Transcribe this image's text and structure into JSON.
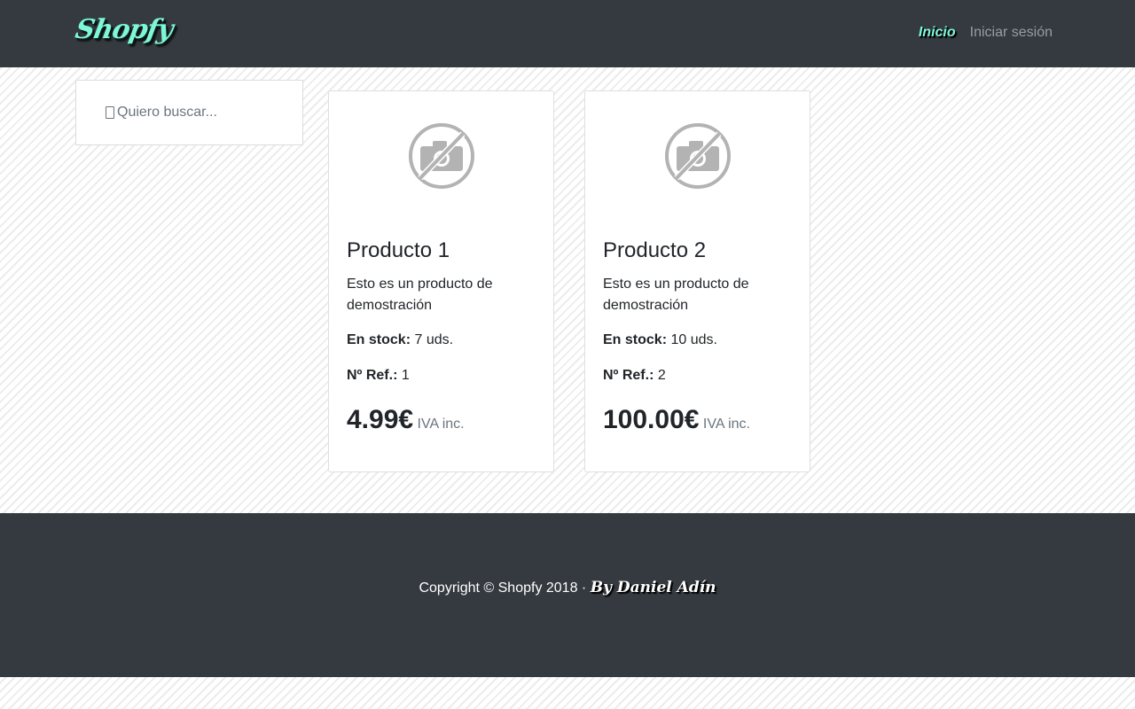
{
  "brand": {
    "logo_text": "Shopfy"
  },
  "nav": {
    "items": [
      {
        "label": "Inicio"
      },
      {
        "label": "Iniciar sesión"
      }
    ]
  },
  "search": {
    "placeholder": "Quiero buscar..."
  },
  "products": [
    {
      "title": "Producto 1",
      "description": "Esto es un producto de demostración",
      "stock_label": "En stock:",
      "stock_value": "7 uds.",
      "ref_label": "Nº Ref.:",
      "ref_value": "1",
      "price": "4.99€",
      "price_note": "IVA inc.",
      "image_icon": "no-photo-icon"
    },
    {
      "title": "Producto 2",
      "description": "Esto es un producto de demostración",
      "stock_label": "En stock:",
      "stock_value": "10 uds.",
      "ref_label": "Nº Ref.:",
      "ref_value": "2",
      "price": "100.00€",
      "price_note": "IVA inc.",
      "image_icon": "no-photo-icon"
    }
  ],
  "footer": {
    "copyright": "Copyright © Shopfy 2018 · ",
    "author": "By Daniel Adín"
  },
  "colors": {
    "navbar_bg": "#343a40",
    "accent": "#7df7d8",
    "nav_muted": "#9a9da0"
  }
}
